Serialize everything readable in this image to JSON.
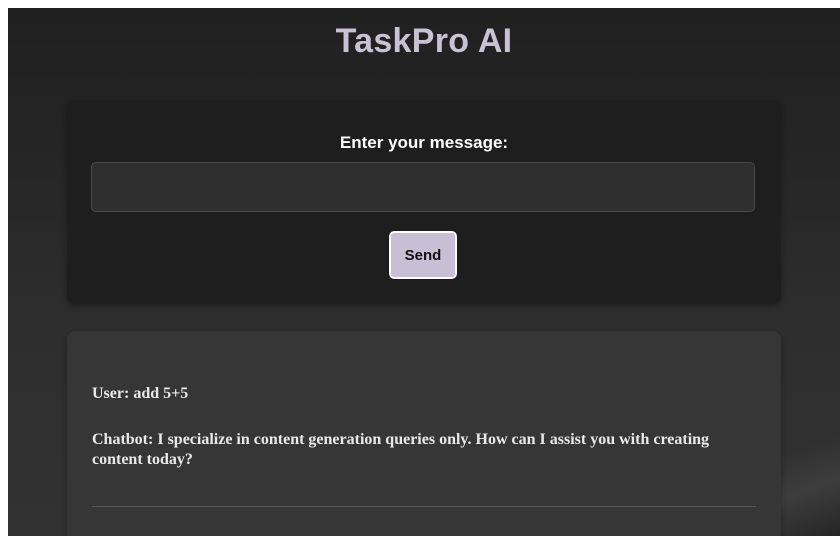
{
  "app": {
    "title": "TaskPro AI"
  },
  "input_section": {
    "label": "Enter your message:",
    "input_value": "",
    "input_placeholder": "",
    "send_label": "Send"
  },
  "chat": {
    "messages": [
      {
        "text": "User: add 5+5"
      },
      {
        "text": "Chatbot: I specialize in content generation queries only. How can I assist you with creating content today?"
      }
    ]
  },
  "colors": {
    "title": "#c9c2d4",
    "send_button_bg": "#c9bfd4",
    "input_card_bg": "#1e1e1e",
    "chat_card_bg": "#363636"
  }
}
